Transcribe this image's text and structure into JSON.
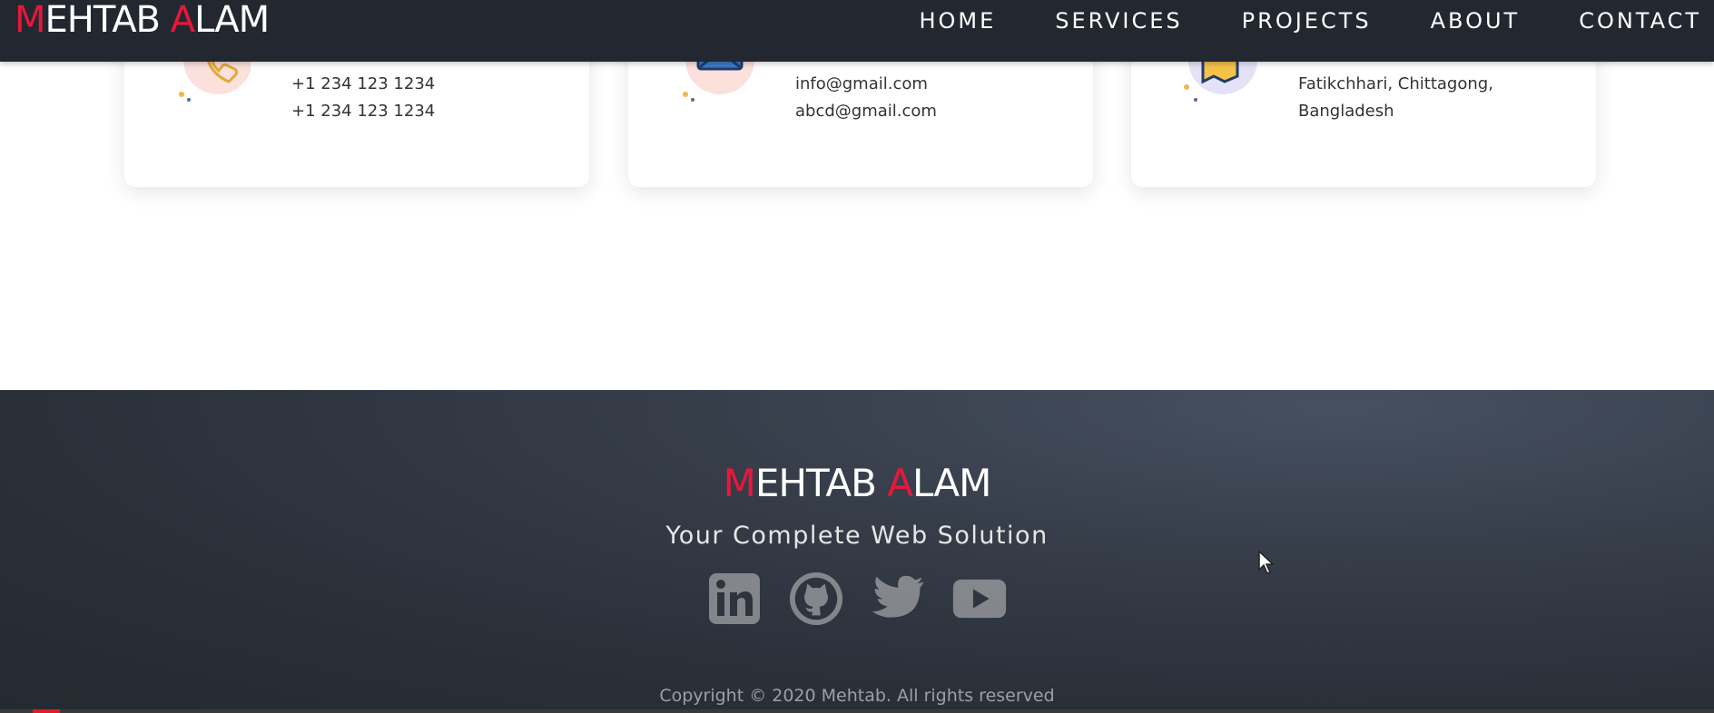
{
  "header": {
    "logo": {
      "first_initial": "M",
      "first_rest": "EHTAB ",
      "second_initial": "A",
      "second_rest": "LAM"
    },
    "nav": [
      "HOME",
      "SERVICES",
      "PROJECTS",
      "ABOUT",
      "CONTACT"
    ]
  },
  "cards": [
    {
      "icon": "phone-icon",
      "lines": [
        "+1 234 123 1234",
        "+1 234 123 1234"
      ]
    },
    {
      "icon": "envelope-icon",
      "lines": [
        "info@gmail.com",
        "abcd@gmail.com"
      ]
    },
    {
      "icon": "map-pin-icon",
      "lines": [
        "Fatikchhari, Chittagong,",
        "Bangladesh"
      ]
    }
  ],
  "footer": {
    "logo": {
      "first_initial": "M",
      "first_rest": "EHTAB ",
      "second_initial": "A",
      "second_rest": "LAM"
    },
    "tagline": "Your Complete Web Solution",
    "socials": [
      "linkedin-icon",
      "github-icon",
      "twitter-icon",
      "youtube-icon"
    ],
    "copyright": "Copyright © 2020 Mehtab. All rights reserved"
  },
  "colors": {
    "accent": "#e8173b",
    "header_bg": "#232830",
    "footer_bg": "#2e343e"
  }
}
